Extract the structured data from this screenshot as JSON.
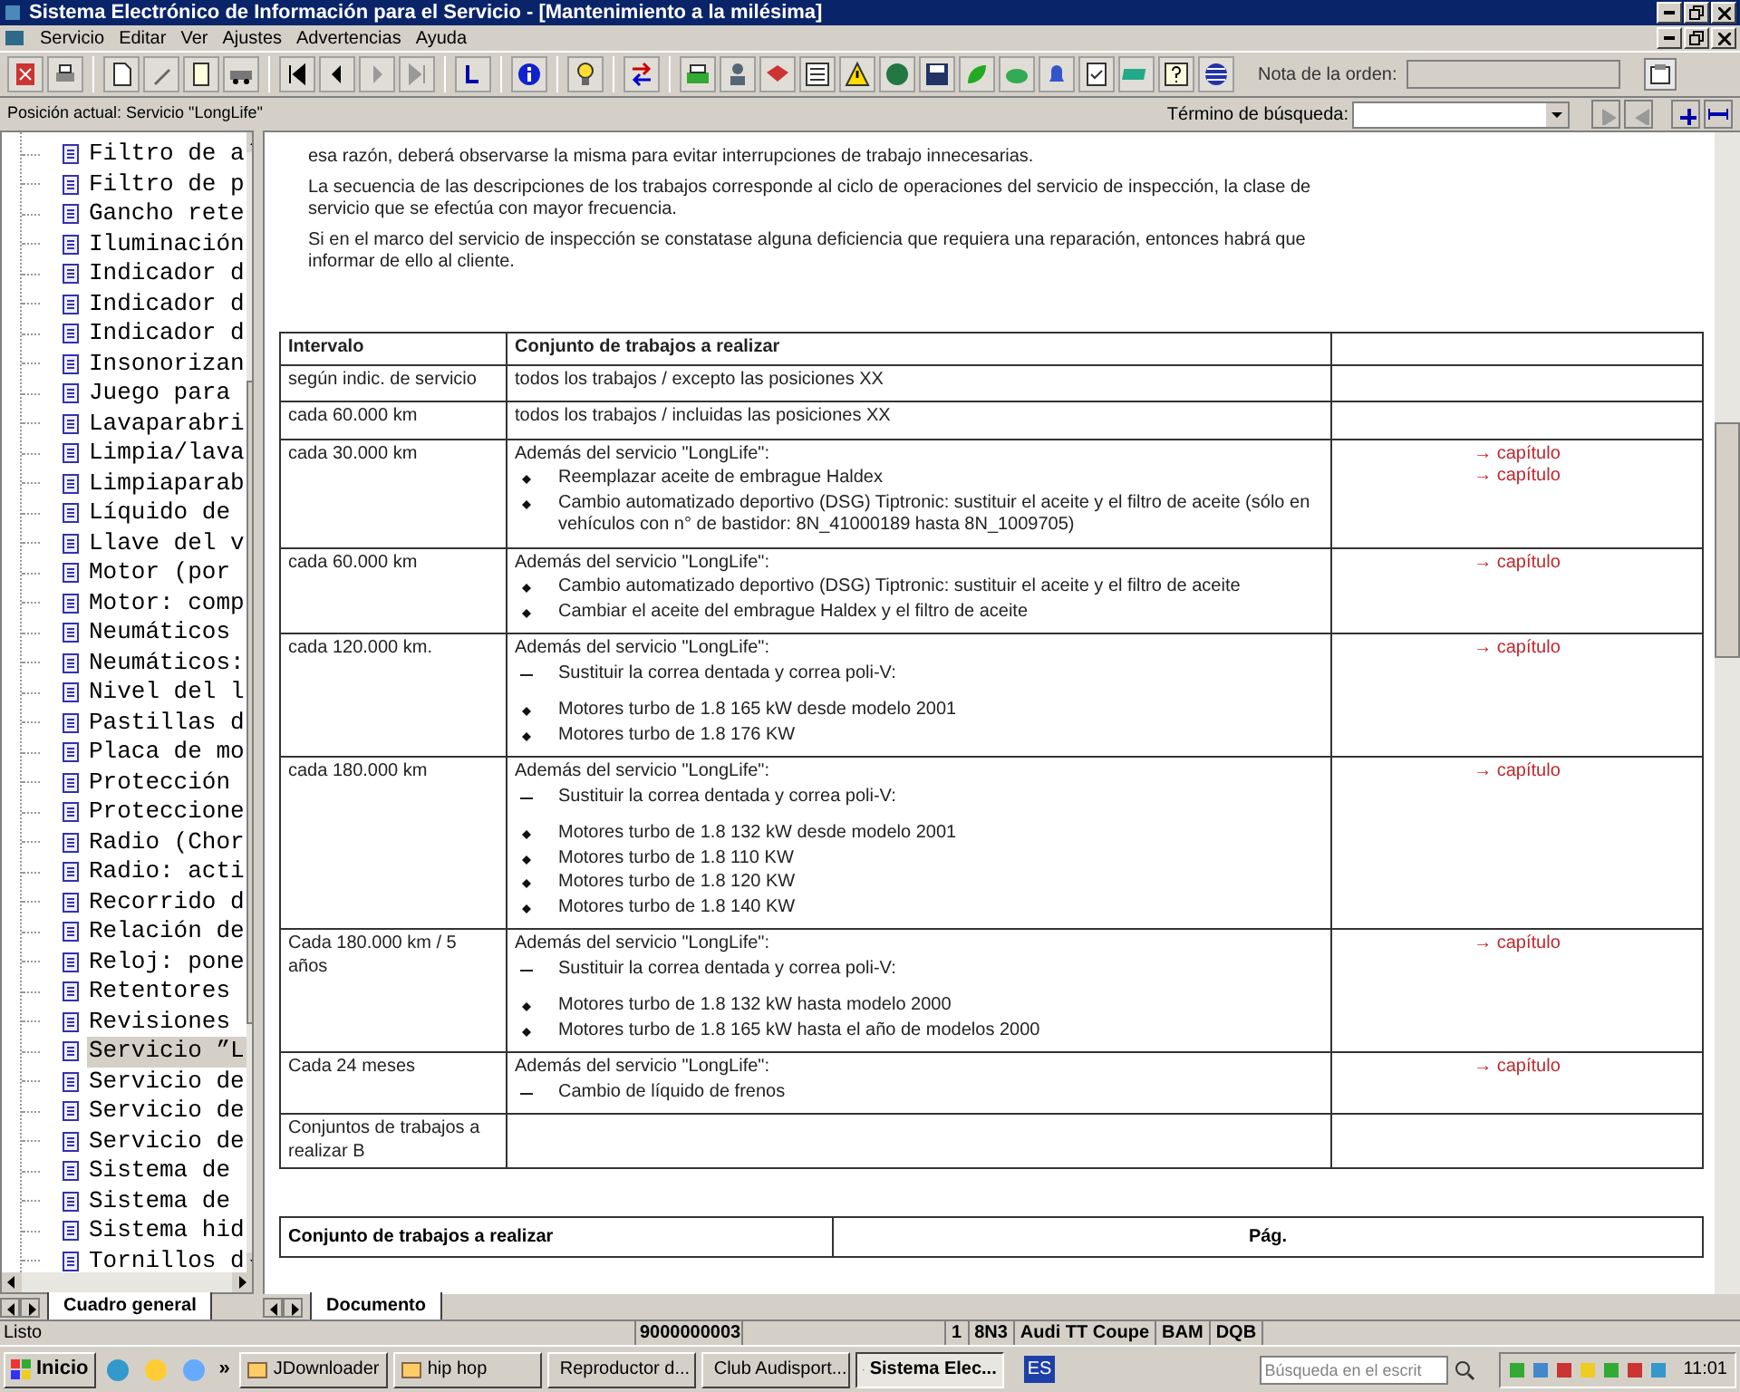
{
  "window": {
    "title": "Sistema Electrónico de Información para el Servicio - [Mantenimiento a la milésima]"
  },
  "menu": [
    "Servicio",
    "Editar",
    "Ver",
    "Ajustes",
    "Advertencias",
    "Ayuda"
  ],
  "order_note": {
    "label": "Nota de la orden:"
  },
  "position": "Posición actual: Servicio \"LongLife\"",
  "search": {
    "label": "Término de búsqueda:"
  },
  "tree": [
    {
      "label": "Filtro de a",
      "selected": false
    },
    {
      "label": "Filtro de p",
      "selected": false
    },
    {
      "label": "Gancho rete",
      "selected": false
    },
    {
      "label": "Iluminación",
      "selected": false
    },
    {
      "label": "Indicador d",
      "selected": false
    },
    {
      "label": "Indicador d",
      "selected": false
    },
    {
      "label": "Indicador d",
      "selected": false
    },
    {
      "label": "Insonorizan",
      "selected": false
    },
    {
      "label": "Juego para",
      "selected": false
    },
    {
      "label": "Lavaparabri",
      "selected": false
    },
    {
      "label": "Limpia/lava",
      "selected": false
    },
    {
      "label": "Limpiaparab",
      "selected": false
    },
    {
      "label": "Líquido de",
      "selected": false
    },
    {
      "label": "Llave del v",
      "selected": false
    },
    {
      "label": "Motor (por",
      "selected": false
    },
    {
      "label": "Motor: comp",
      "selected": false
    },
    {
      "label": "Neumáticos",
      "selected": false
    },
    {
      "label": "Neumáticos:",
      "selected": false
    },
    {
      "label": "Nivel del l",
      "selected": false
    },
    {
      "label": "Pastillas d",
      "selected": false
    },
    {
      "label": "Placa de mo",
      "selected": false
    },
    {
      "label": "Protección",
      "selected": false
    },
    {
      "label": "Proteccione",
      "selected": false
    },
    {
      "label": "Radio (Chor",
      "selected": false
    },
    {
      "label": "Radio: acti",
      "selected": false
    },
    {
      "label": "Recorrido d",
      "selected": false
    },
    {
      "label": "Relación de",
      "selected": false
    },
    {
      "label": "Reloj: pone",
      "selected": false
    },
    {
      "label": "Retentores",
      "selected": false
    },
    {
      "label": "Revisiones",
      "selected": false
    },
    {
      "label": "Servicio ”L",
      "selected": true
    },
    {
      "label": "Servicio de",
      "selected": false
    },
    {
      "label": "Servicio de",
      "selected": false
    },
    {
      "label": "Servicio de",
      "selected": false
    },
    {
      "label": "Sistema de",
      "selected": false
    },
    {
      "label": "Sistema de",
      "selected": false
    },
    {
      "label": "Sistema hid",
      "selected": false
    },
    {
      "label": "Tornillos d",
      "selected": false
    }
  ],
  "left_tab": "Cuadro general",
  "right_tab": "Documento",
  "paragraphs": [
    "esa razón, deberá observarse la misma para evitar interrupciones de trabajo innecesarias.",
    "La secuencia de las descripciones de los trabajos corresponde al ciclo de operaciones del servicio de inspección, la clase de servicio que se efectúa con mayor frecuencia.",
    "Si en el marco del servicio de inspección se constatase alguna deficiencia que requiera una reparación, entonces habrá que informar de ello al cliente."
  ],
  "table": {
    "columns": [
      "Intervalo",
      "Conjunto de trabajos a realizar"
    ],
    "rows": [
      {
        "interval": "según indic. de servicio",
        "text": "todos los trabajos / excepto las posiciones XX",
        "links": []
      },
      {
        "interval": "cada 60.000 km",
        "text": "todos los trabajos / incluidas las posiciones XX",
        "links": []
      },
      {
        "interval": "cada 30.000 km",
        "text": "Además del servicio \"LongLife\":",
        "items": [
          {
            "kind": "bullet",
            "text": "Reemplazar aceite de embrague Haldex"
          },
          {
            "kind": "bullet",
            "text": "Cambio automatizado deportivo (DSG) Tiptronic: sustituir el aceite y el filtro de aceite (sólo en vehículos con n° de bastidor: 8N_41000189 hasta 8N_1009705)"
          }
        ],
        "links": [
          "→ capítulo",
          "→ capítulo"
        ]
      },
      {
        "interval": "cada 60.000 km",
        "text": "Además del servicio \"LongLife\":",
        "items": [
          {
            "kind": "bullet",
            "text": "Cambio automatizado deportivo (DSG) Tiptronic: sustituir el aceite y el filtro de aceite"
          },
          {
            "kind": "bullet",
            "text": "Cambiar el aceite del embrague Haldex y el filtro de aceite"
          }
        ],
        "links": [
          "→ capítulo"
        ]
      },
      {
        "interval": "cada 120.000 km.",
        "text": "Además del servicio \"LongLife\":",
        "items": [
          {
            "kind": "dash",
            "text": "Sustituir la correa dentada y correa poli-V:"
          },
          {
            "kind": "bullet",
            "text": "Motores turbo de 1.8 165 kW desde modelo 2001"
          },
          {
            "kind": "bullet",
            "text": "Motores turbo de 1.8 176 KW"
          }
        ],
        "links": [
          "→ capítulo"
        ]
      },
      {
        "interval": "cada 180.000 km",
        "text": "Además del servicio \"LongLife\":",
        "items": [
          {
            "kind": "dash",
            "text": "Sustituir la correa dentada y correa poli-V:"
          },
          {
            "kind": "bullet",
            "text": "Motores turbo de 1.8 132 kW desde modelo 2001"
          },
          {
            "kind": "bullet",
            "text": "Motores turbo de 1.8 110 KW"
          },
          {
            "kind": "bullet",
            "text": "Motores turbo de 1.8 120 KW"
          },
          {
            "kind": "bullet",
            "text": "Motores turbo de 1.8 140 KW"
          }
        ],
        "links": [
          "→ capítulo"
        ]
      },
      {
        "interval": "Cada 180.000 km / 5 años",
        "text": "Además del servicio \"LongLife\":",
        "items": [
          {
            "kind": "dash",
            "text": "Sustituir la correa dentada y correa poli-V:"
          },
          {
            "kind": "bullet",
            "text": "Motores turbo de 1.8 132 kW hasta modelo 2000"
          },
          {
            "kind": "bullet",
            "text": "Motores turbo de 1.8 165 kW hasta el año de modelos 2000"
          }
        ],
        "links": [
          "→ capítulo"
        ]
      },
      {
        "interval": "Cada 24 meses",
        "text": "Además del servicio \"LongLife\":",
        "items": [
          {
            "kind": "dash",
            "text": "Cambio de líquido de frenos"
          }
        ],
        "links": [
          "→ capítulo"
        ]
      },
      {
        "interval": "Conjuntos de trabajos a realizar B",
        "links": []
      }
    ]
  },
  "table2": {
    "columns": [
      "Conjunto de trabajos a realizar",
      "Pág."
    ]
  },
  "status_bar": [
    "Listo",
    "9000000003",
    "1",
    "8N3",
    "Audi TT Coupe",
    "BAM",
    "DQB"
  ],
  "taskbar": {
    "start": "Inicio",
    "more": "»",
    "tasks": [
      {
        "label": "JDownloader",
        "selected": false
      },
      {
        "label": "hip hop",
        "selected": false
      },
      {
        "label": "Reproductor d...",
        "selected": false
      },
      {
        "label": "Club Audisport...",
        "selected": false
      },
      {
        "label": "Sistema Elec...",
        "selected": true
      }
    ],
    "language": "ES",
    "search_placeholder": "Búsqueda en el escrit",
    "clock": "11:01"
  }
}
